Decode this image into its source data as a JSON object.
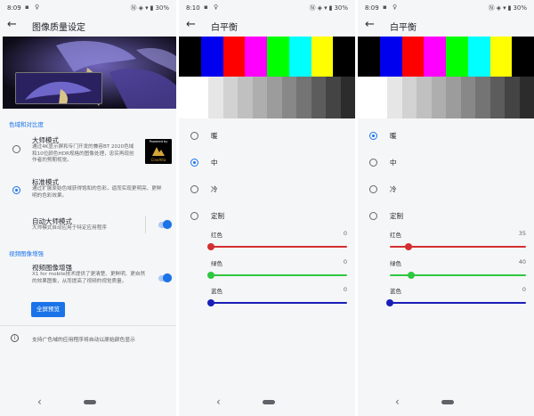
{
  "status": {
    "s1_time": "8:09",
    "s2_time": "8:10",
    "s3_time": "8:09",
    "battery": "30%"
  },
  "image_quality": {
    "title": "图像质量设定",
    "section_color": "色域和对比度",
    "options": [
      {
        "title": "大师模式",
        "desc": "通过4K显示屏和专门开发的兼容BT 2020色域和10位颜色HDR规格的图像处理，忠实再现创作者的预期视觉。",
        "selected": false
      },
      {
        "title": "标准模式",
        "desc": "通过扩展原始色域获得饱和的色彩，逼而实现更明亮、更鲜明的色彩效果。",
        "selected": true
      }
    ],
    "badge": {
      "top": "Powered by",
      "brand": "CineAlta"
    },
    "auto_master": {
      "title": "自动大师模式",
      "desc": "大师模式自动应用于特定应用程序",
      "on": true
    },
    "section_video": "视频图像增强",
    "video_enh": {
      "title": "视频图像增强",
      "desc": "X1 for mobile技术提供了更清楚、更鲜明、更自然的效果图像，从而提高了视频的视觉质量。",
      "on": true
    },
    "preview_button": "全屏预览",
    "footer_note": "支持广色域的应用程序将自动以原始颜色显示"
  },
  "white_balance": {
    "title": "白平衡",
    "color_bars": [
      "#000000",
      "#0000ee",
      "#ff0000",
      "#ff00ff",
      "#00ff00",
      "#00ffff",
      "#ffff00",
      "#000000"
    ],
    "gray_bars": [
      "#ffffff",
      "#ffffff",
      "#e6e6e6",
      "#d2d2d2",
      "#c0c0c0",
      "#aeaeae",
      "#9c9c9c",
      "#888888",
      "#747474",
      "#5c5c5c",
      "#444444",
      "#2c2c2c"
    ],
    "options": [
      "暖",
      "中",
      "冷",
      "定制"
    ],
    "sliders": [
      {
        "label": "红色",
        "color": "#d32f2f"
      },
      {
        "label": "绿色",
        "color": "#2ec840"
      },
      {
        "label": "蓝色",
        "color": "#1a1fb8"
      }
    ],
    "screen_a": {
      "selected": "中",
      "values": [
        0,
        0,
        0
      ]
    },
    "screen_b": {
      "selected": "暖",
      "values": [
        35,
        40,
        0
      ]
    },
    "slider_max": 255
  },
  "accent_color": "#1a73e8"
}
